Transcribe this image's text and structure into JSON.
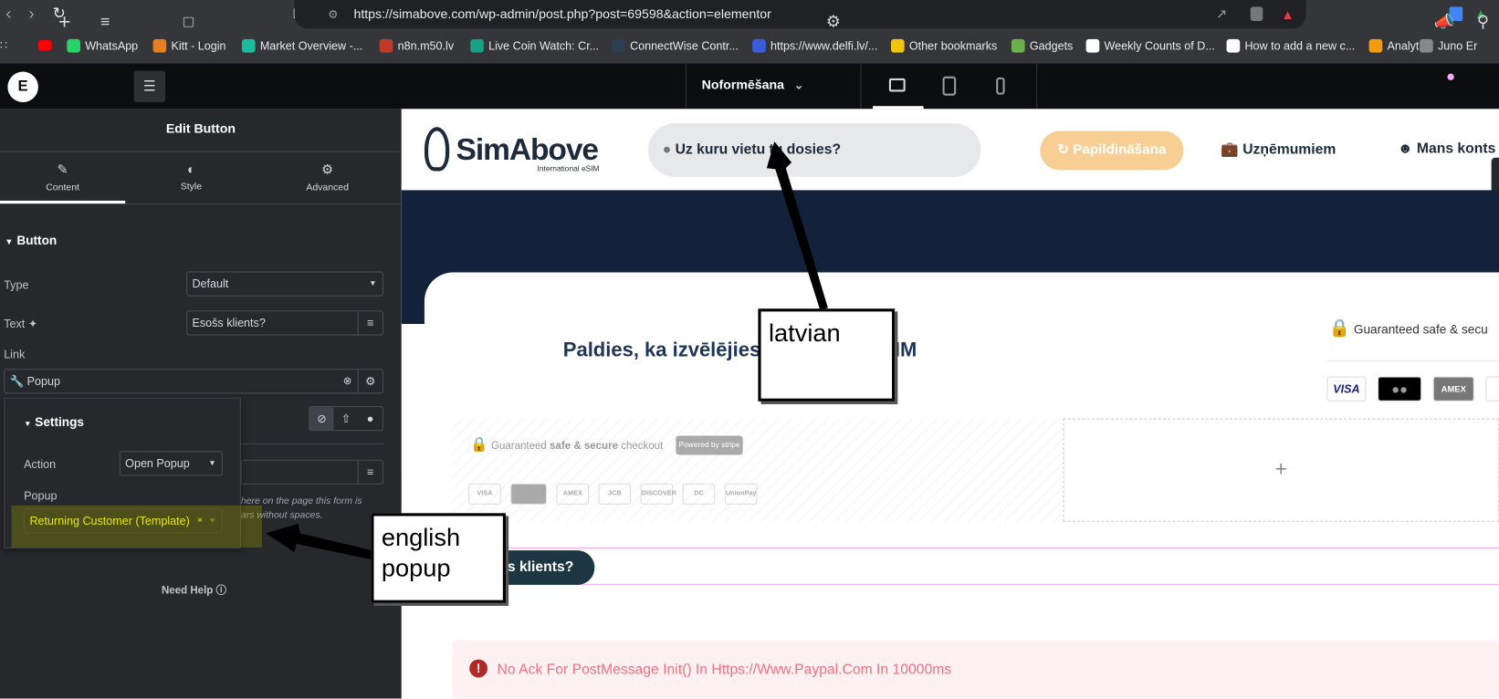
{
  "browser": {
    "url": "https://simabove.com/wp-admin/post.php?post=69598&action=elementor",
    "bookmarks": [
      {
        "label": "WhatsApp",
        "color": "#25d366"
      },
      {
        "label": "Kitt - Login",
        "color": "#e67e22"
      },
      {
        "label": "Market Overview -...",
        "color": "#1abc9c"
      },
      {
        "label": "n8n.m50.lv",
        "color": "#c0392b"
      },
      {
        "label": "Live Coin Watch: Cr...",
        "color": "#16a085"
      },
      {
        "label": "ConnectWise Contr...",
        "color": "#2c3e50"
      },
      {
        "label": "https://www.delfi.lv/...",
        "color": "#3b5bdb"
      },
      {
        "label": "Other bookmarks",
        "color": "#f1c40f"
      },
      {
        "label": "Gadgets",
        "color": "#6ab04c"
      },
      {
        "label": "Weekly Counts of D...",
        "color": "#ffffff"
      },
      {
        "label": "How to add a new c...",
        "color": "#ffffff"
      },
      {
        "label": "Analytics",
        "color": "#f39c12"
      },
      {
        "label": "Juno Er",
        "color": "#888888"
      }
    ]
  },
  "editor": {
    "device_label": "Noformēšana",
    "panel_title": "Edit Button",
    "tabs": [
      "Content",
      "Style",
      "Advanced"
    ],
    "section": "Button",
    "type_label": "Type",
    "type_value": "Default",
    "text_label": "Text",
    "text_value": "Esošs klients?",
    "link_label": "Link",
    "link_value": "Popup",
    "settings_title": "Settings",
    "action_label": "Action",
    "action_value": "Open Popup",
    "popup_label": "Popup",
    "popup_value": "Returning Customer (Template)",
    "help_text_1": "here on the page this form is",
    "help_text_2": "ars without spaces.",
    "need_help": "Need Help"
  },
  "site": {
    "logo": "SimAbove",
    "logo_sub": "International eSIM",
    "search_placeholder": "Uz kuru vietu tu dosies?",
    "nav": [
      "Papildināšana",
      "Uzņēmumiem",
      "Mans konts"
    ],
    "heading": "Paldies, ka izvēlējies SimAbove eSIM",
    "secure_prefix": "Guaranteed",
    "secure_bold": "safe & secure",
    "secure_suffix": "checkout",
    "secure_right": "Guaranteed safe & secu",
    "stripe": "Powered by stripe",
    "cards": [
      "VISA",
      "MC",
      "AMEX",
      "JCB",
      "DISCOVER",
      "DC",
      "UnionPay"
    ],
    "button_text": "s klients?",
    "error": "No Ack For PostMessage Init() In Https://Www.Paypal.Com In 10000ms",
    "plus": "+"
  },
  "annotations": {
    "latvian": "latvian",
    "english_1": "english",
    "english_2": "popup"
  }
}
